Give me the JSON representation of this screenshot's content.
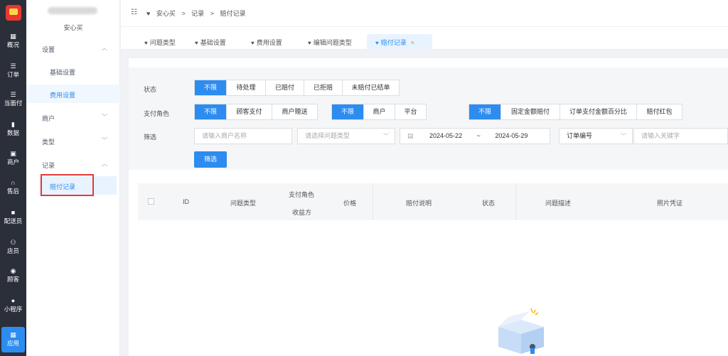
{
  "rail": {
    "items": [
      {
        "label": "概况",
        "icon": "dashboard-icon",
        "glyph": "▦"
      },
      {
        "label": "订单",
        "icon": "order-icon",
        "glyph": "☰"
      },
      {
        "label": "当面付",
        "icon": "pay-icon",
        "glyph": "☰"
      },
      {
        "label": "数据",
        "icon": "chart-icon",
        "glyph": "▮"
      },
      {
        "label": "商户",
        "icon": "store-icon",
        "glyph": "▣"
      },
      {
        "label": "售后",
        "icon": "headset-icon",
        "glyph": "∩"
      },
      {
        "label": "配送员",
        "icon": "courier-icon",
        "glyph": "■"
      },
      {
        "label": "店员",
        "icon": "staff-icon",
        "glyph": "⚇"
      },
      {
        "label": "顾客",
        "icon": "customer-icon",
        "glyph": "◉"
      },
      {
        "label": "小程序",
        "icon": "chat-icon",
        "glyph": "●"
      },
      {
        "label": "应用",
        "icon": "apps-icon",
        "glyph": "▦"
      }
    ],
    "active_index": 10
  },
  "sidebar": {
    "shop_name": "安心买",
    "groups": [
      {
        "label": "设置",
        "chevron": "︿"
      },
      {
        "label": "商户",
        "chevron": "﹀"
      },
      {
        "label": "类型",
        "chevron": "﹀"
      },
      {
        "label": "记录",
        "chevron": "︿"
      }
    ],
    "settings_items": [
      "基础设置",
      "费用设置"
    ],
    "record_items": [
      "赔付记录"
    ]
  },
  "breadcrumb": {
    "fold_icon": "☷",
    "items": [
      "安心买",
      ">",
      "记录",
      ">",
      "赔付记录"
    ]
  },
  "tabs": [
    {
      "label": "问题类型"
    },
    {
      "label": "基础设置"
    },
    {
      "label": "费用设置"
    },
    {
      "label": "编辑问题类型"
    },
    {
      "label": "赔付记录",
      "close": "×"
    }
  ],
  "filters": {
    "status_label": "状态",
    "status_options": [
      "不限",
      "待处理",
      "已赔付",
      "已拒赔",
      "未赔付已结单"
    ],
    "role_label": "支付角色",
    "role_options_a": [
      "不限",
      "顾客支付",
      "商户赠送"
    ],
    "role_options_b": [
      "不限",
      "商户",
      "平台"
    ],
    "role_options_c": [
      "不限",
      "固定金额赔付",
      "订单支付金额百分比",
      "赔付红包"
    ],
    "search_label": "筛选",
    "merchant_placeholder": "请输入商户名称",
    "type_placeholder": "请选择问题类型",
    "date_start": "2024-05-22",
    "date_sep": "~",
    "date_end": "2024-05-29",
    "order_select": "订单编号",
    "keyword_placeholder": "请输入关键字",
    "filter_button": "筛选"
  },
  "table": {
    "headers": [
      "ID",
      "问题类型",
      "支付角色",
      "收益方",
      "价格",
      "赔付说明",
      "状态",
      "问题描述",
      "照片凭证"
    ]
  },
  "colors": {
    "primary": "#2d8cf0",
    "rail_bg": "#2b2f3a",
    "highlight_box": "#e53935"
  }
}
